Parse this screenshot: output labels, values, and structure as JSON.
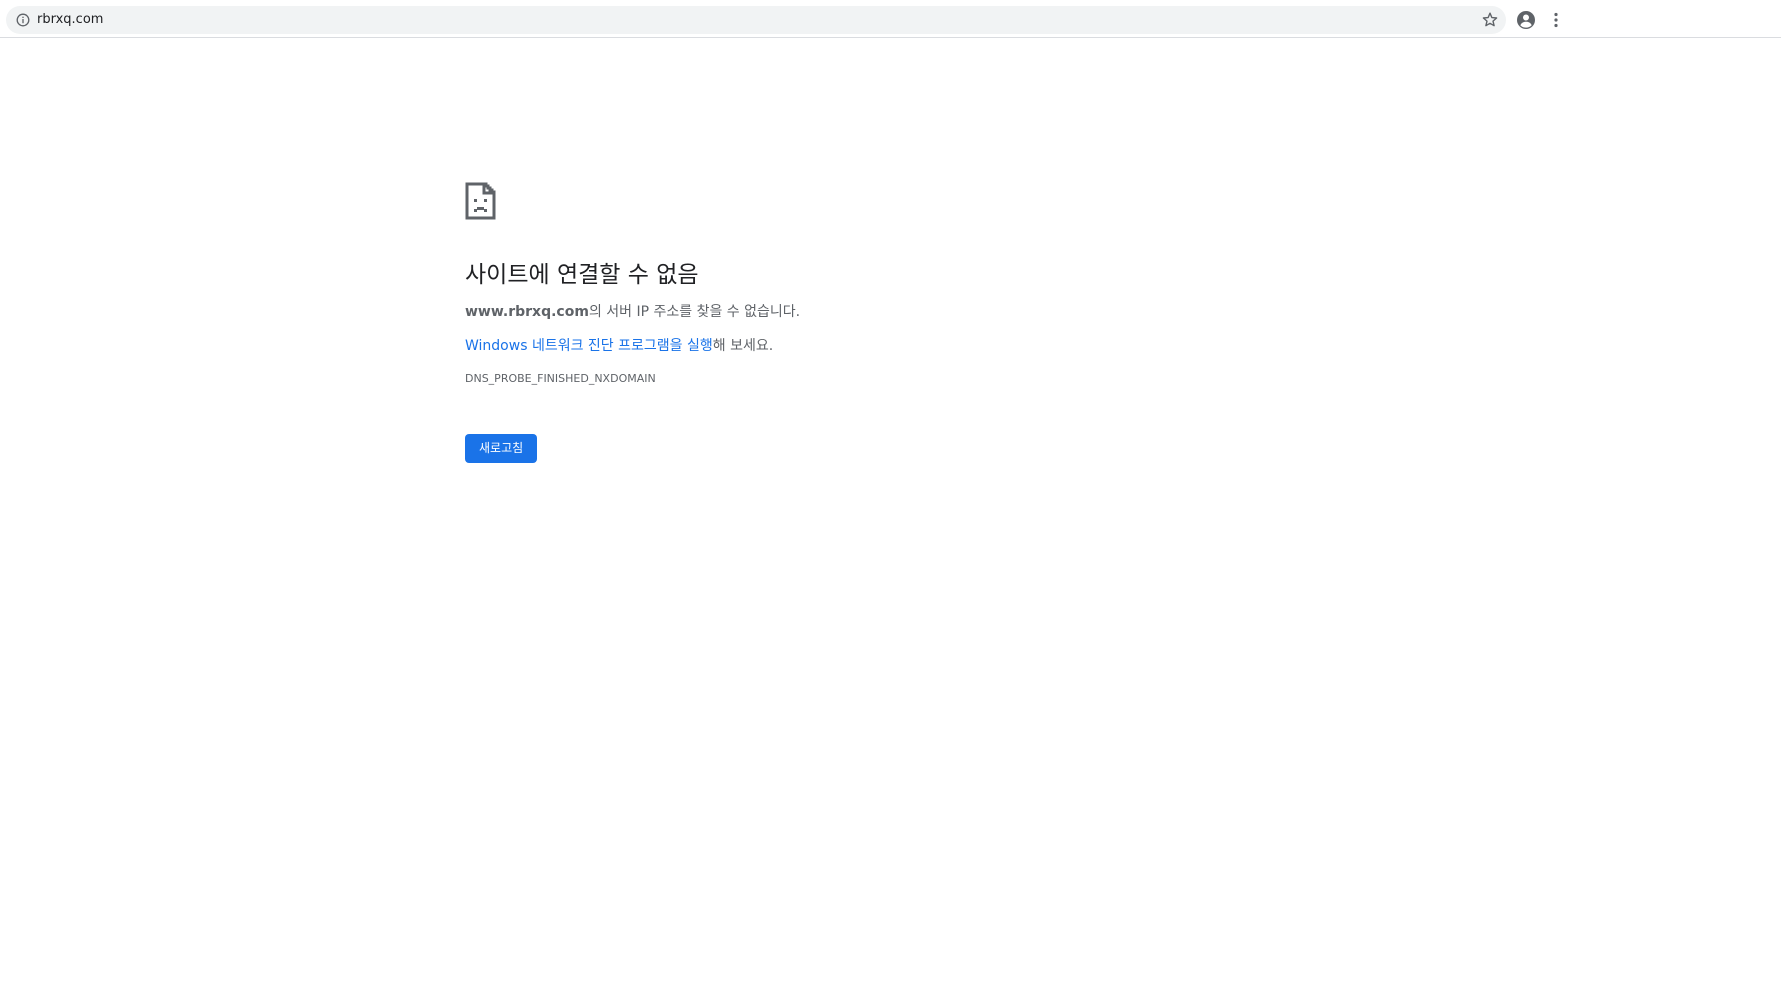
{
  "browser": {
    "url": "rbrxq.com",
    "icons": {
      "site_info": "info-icon",
      "bookmark": "star-icon",
      "profile": "profile-icon",
      "menu": "menu-icon"
    },
    "accent_color": "#d8642a"
  },
  "error_page": {
    "icon": "sad-file-icon",
    "title": "사이트에 연결할 수 없음",
    "host": "www.rbrxq.com",
    "host_suffix": "의 서버 IP 주소를 찾을 수 없습니다.",
    "diagnostics_link": "Windows 네트워크 진단 프로그램을 실행",
    "diagnostics_suffix": "해 보세요.",
    "error_code": "DNS_PROBE_FINISHED_NXDOMAIN",
    "reload_label": "새로고침",
    "button_color": "#1a73e8",
    "link_color": "#1a73e8"
  }
}
